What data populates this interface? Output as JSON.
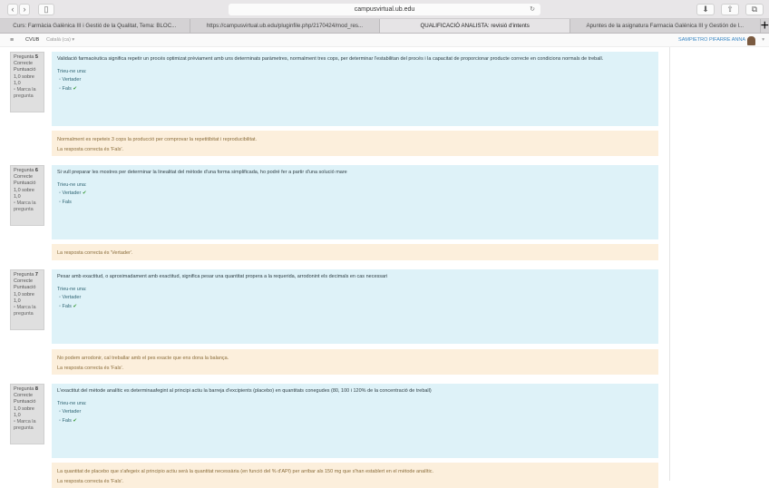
{
  "browser": {
    "url": "campusvirtual.ub.edu",
    "tabs": [
      "Curs: Farmàcia Galènica III i Gestió de la Qualitat, Tema: BLOC...",
      "https://campusvirtual.ub.edu/pluginfile.php/2170424/mod_res...",
      "QUALIFICACIÓ ANALISTA: revisió d'intents",
      "Apuntes de la asignatura Farmacia Galénica III y Gestión de l..."
    ],
    "active_tab": 2
  },
  "nav": {
    "brand": "CVUB",
    "language": "Català (ca) ▾",
    "user": "SAMPIETRO PIFARRE ANNA"
  },
  "common": {
    "prompt": "Trieu-ne una:",
    "status": "Correcte",
    "score_label": "Puntuació",
    "score": "1,0 sobre 1,0",
    "flag": "Marca la pregunta",
    "question_label": "Pregunta",
    "option_true": "Vertader",
    "option_false": "Fals",
    "check": "✔"
  },
  "questions": [
    {
      "number": "5",
      "text": "Validació farmacèutica significa repetir un procés optimizat prèviament amb uns determinats paràmetres, normalment tres cops, per determinar l'estabilitan del procés i la capacitat de proporcionar producte correcte en condicions normals de treball.",
      "correct": "false",
      "feedback": "Normalment es repeteix 3 cops la producció per comprovar la repetitibitat i reproducibilitat.",
      "answer": "La resposta correcta és 'Fals'."
    },
    {
      "number": "6",
      "text": "Si vull preparar les mostres per determinar la linealitat del mètode d'una forma simplificada, ho podré fer a partir d'una solució mare",
      "correct": "true",
      "feedback": "",
      "answer": "La resposta correcta és 'Vertader'."
    },
    {
      "number": "7",
      "text": "Pesar amb exactitud, o aproximadament amb exactitud, significa pesar una quantitat propera a la requerida, arrodonint els decimals en cas necessari",
      "correct": "false",
      "feedback": "No podem arrodonir, cal treballar amb el pes exacte que ens dona la balança.",
      "answer": "La resposta correcta és 'Fals'."
    },
    {
      "number": "8",
      "text": "L'exactitut del mètode analític es determinaafegint al principi actiu la barreja d'excipients (placebo) en quantitats conegudes (80, 100 i 120% de la concentració de treball)",
      "correct": "false",
      "feedback": "La quantitat de placebo que s'afegeix al principio actiu serà la quantitat necessària (en funció del % d'API) per arribar als 150 mg que s'han establert en el mètode analític.",
      "answer": "La resposta correcta és 'Fals'."
    }
  ]
}
